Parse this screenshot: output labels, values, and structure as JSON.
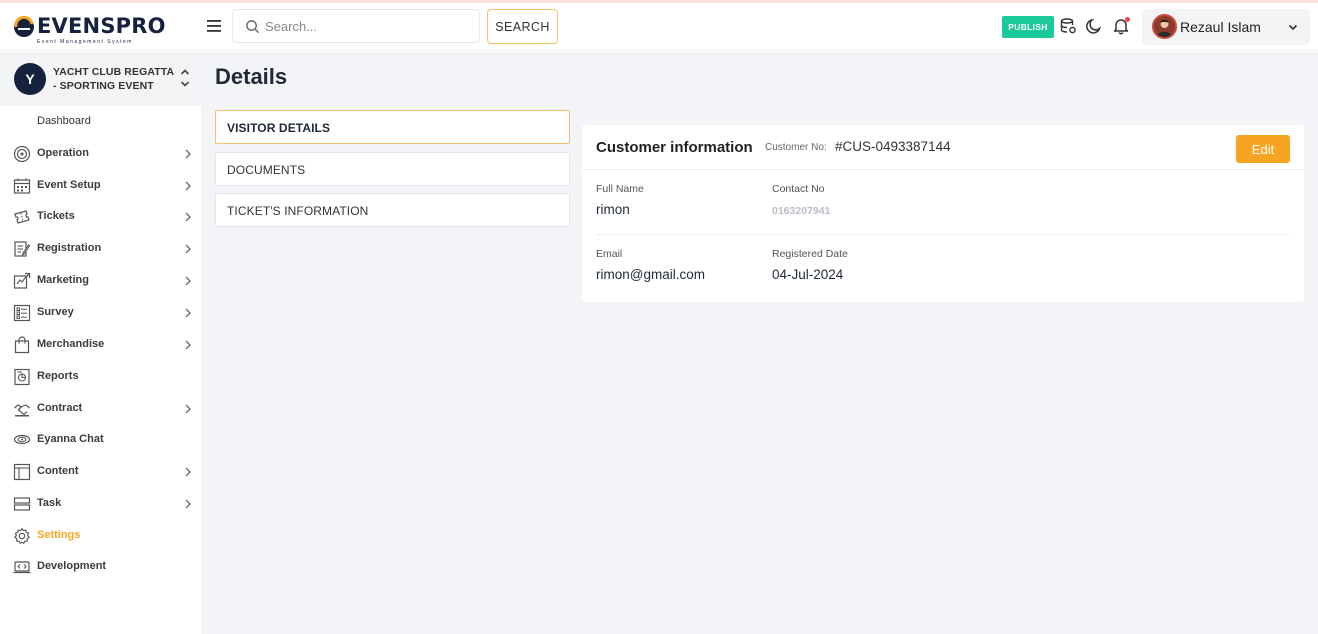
{
  "colors": {
    "accent": "#f5a623",
    "publish": "#1cc99a",
    "brand_navy": "#16213e",
    "edit": "#f6a421"
  },
  "logo": {
    "name": "EVENSPRO",
    "tagline": "Event Management System"
  },
  "header": {
    "search_placeholder": "Search...",
    "search_button": "SEARCH",
    "publish_button": "PUBLISH",
    "icons": [
      "menu-icon",
      "database-icon",
      "moon-icon",
      "bell-icon"
    ],
    "user_name": "Rezaul Islam"
  },
  "sidebar": {
    "event": {
      "initial": "Y",
      "name": "YACHT CLUB REGATTA - SPORTING EVENT"
    },
    "items": [
      {
        "label": "Dashboard",
        "icon": "",
        "arrow": false
      },
      {
        "label": "Operation",
        "icon": "operation-icon",
        "arrow": true
      },
      {
        "label": "Event Setup",
        "icon": "calendar-icon",
        "arrow": true
      },
      {
        "label": "Tickets",
        "icon": "tickets-icon",
        "arrow": true
      },
      {
        "label": "Registration",
        "icon": "registration-icon",
        "arrow": true
      },
      {
        "label": "Marketing",
        "icon": "marketing-icon",
        "arrow": true
      },
      {
        "label": "Survey",
        "icon": "survey-icon",
        "arrow": true
      },
      {
        "label": "Merchandise",
        "icon": "bag-icon",
        "arrow": true
      },
      {
        "label": "Reports",
        "icon": "reports-icon",
        "arrow": false
      },
      {
        "label": "Contract",
        "icon": "contract-icon",
        "arrow": true
      },
      {
        "label": "Eyanna Chat",
        "icon": "chat-icon",
        "arrow": false
      },
      {
        "label": "Content",
        "icon": "content-icon",
        "arrow": true
      },
      {
        "label": "Task",
        "icon": "task-icon",
        "arrow": true
      },
      {
        "label": "Settings",
        "icon": "gear-icon",
        "arrow": false,
        "active": true
      },
      {
        "label": "Development",
        "icon": "development-icon",
        "arrow": false
      }
    ]
  },
  "main": {
    "title": "Details",
    "tabs": [
      {
        "label": "VISITOR DETAILS",
        "active": true
      },
      {
        "label": "DOCUMENTS",
        "active": false
      },
      {
        "label": "TICKET'S INFORMATION",
        "active": false
      }
    ],
    "card": {
      "title": "Customer information",
      "customer_no_label": "Customer No:",
      "customer_no": "#CUS-0493387144",
      "edit_button": "Edit",
      "fields": {
        "full_name_label": "Full Name",
        "full_name": "rimon",
        "contact_label": "Contact No",
        "contact": "0163207941",
        "email_label": "Email",
        "email": "rimon@gmail.com",
        "registered_label": "Registered Date",
        "registered": "04-Jul-2024"
      }
    }
  }
}
